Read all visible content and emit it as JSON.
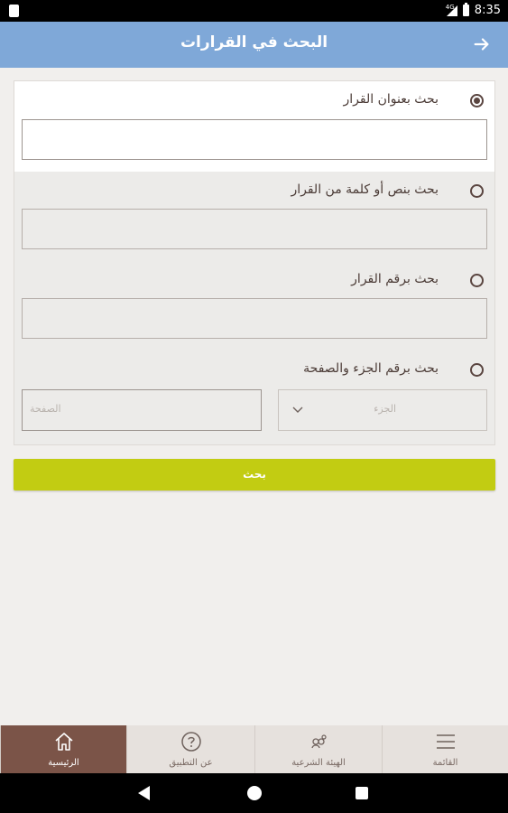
{
  "status_bar": {
    "network": "4G",
    "time": "8:35"
  },
  "header": {
    "title": "البحث في القرارات"
  },
  "form": {
    "options": [
      {
        "label": "بحث بعنوان القرار",
        "checked": true,
        "value": ""
      },
      {
        "label": "بحث بنص أو كلمة من القرار",
        "checked": false,
        "value": ""
      },
      {
        "label": "بحث برقم القرار",
        "checked": false,
        "value": ""
      },
      {
        "label": "بحث برقم الجزء والصفحة",
        "checked": false
      }
    ],
    "part_placeholder": "الجزء",
    "page_placeholder": "الصفحة"
  },
  "search_button": {
    "label": "بحث"
  },
  "bottom_nav": {
    "items": [
      {
        "label": "الرئيسية",
        "icon": "home-icon",
        "active": true
      },
      {
        "label": "عن التطبيق",
        "icon": "question-icon",
        "active": false
      },
      {
        "label": "الهيئة الشرعية",
        "icon": "board-icon",
        "active": false
      },
      {
        "label": "القائمة",
        "icon": "menu-icon",
        "active": false
      }
    ]
  },
  "colors": {
    "header": "#7fa8d8",
    "accent": "#c2cc12",
    "nav_active": "#7b5448"
  }
}
